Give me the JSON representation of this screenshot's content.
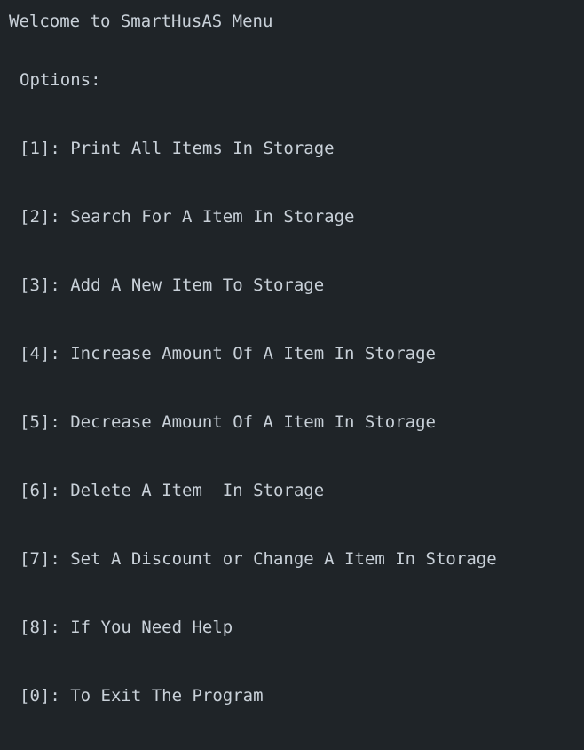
{
  "console": {
    "welcome": "Welcome to SmartHusAS Menu",
    "options_label": "Options:",
    "menu_items": [
      "[1]: Print All Items In Storage",
      "[2]: Search For A Item In Storage",
      "[3]: Add A New Item To Storage",
      "[4]: Increase Amount Of A Item In Storage",
      "[5]: Decrease Amount Of A Item In Storage",
      "[6]: Delete A Item  In Storage",
      "[7]: Set A Discount or Change A Item In Storage",
      "[8]: If You Need Help",
      "[0]: To Exit The Program"
    ]
  },
  "colors": {
    "background": "#1f2428",
    "text": "#c9d1d9"
  }
}
